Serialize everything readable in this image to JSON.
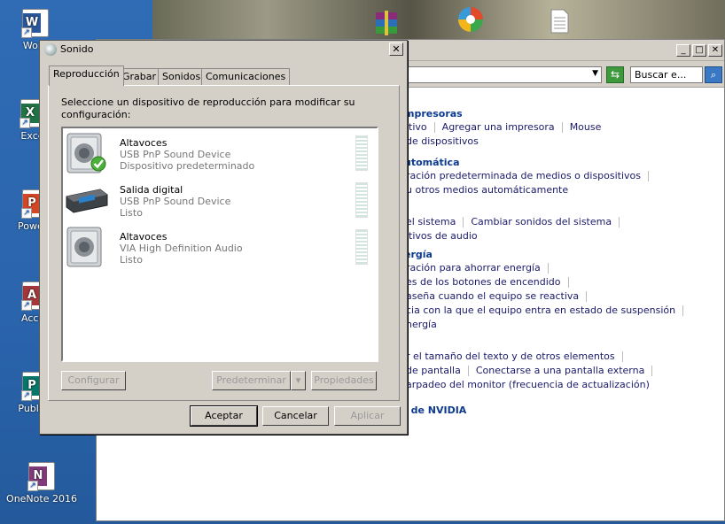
{
  "desktop": {
    "icons": [
      {
        "label": "Word",
        "color": "#2b579a",
        "glyph": "W"
      },
      {
        "label": "Excel",
        "color": "#217346",
        "glyph": "X"
      },
      {
        "label": "PowerP",
        "color": "#d24726",
        "glyph": "P"
      },
      {
        "label": "Acces",
        "color": "#a4373a",
        "glyph": "A"
      },
      {
        "label": "Publish",
        "color": "#077568",
        "glyph": "P"
      },
      {
        "label": "OneNote 2016",
        "color": "#80397b",
        "glyph": "N"
      }
    ]
  },
  "control_panel": {
    "search_placeholder": "Buscar e...",
    "lines": [
      {
        "type": "head",
        "text": "mpresoras"
      },
      {
        "type": "links",
        "items": [
          "itivo",
          "Agregar una impresora",
          "Mouse"
        ]
      },
      {
        "type": "links",
        "items": [
          "de dispositivos"
        ]
      },
      {
        "type": "head",
        "text": "utomática"
      },
      {
        "type": "links",
        "items": [
          "ración predeterminada de medios o dispositivos"
        ]
      },
      {
        "type": "links",
        "items": [
          "u otros medios automáticamente"
        ]
      },
      {
        "type": "links",
        "items": [
          "el sistema",
          "Cambiar sonidos del sistema"
        ]
      },
      {
        "type": "links",
        "items": [
          "itivos de audio"
        ]
      },
      {
        "type": "head",
        "text": "ergía"
      },
      {
        "type": "links",
        "items": [
          "ración para ahorrar energía"
        ]
      },
      {
        "type": "links",
        "items": [
          "es de los botones de encendido"
        ]
      },
      {
        "type": "links",
        "items": [
          "aseña cuando el equipo se reactiva"
        ]
      },
      {
        "type": "links",
        "items": [
          "cia con la que el equipo entra en estado de suspensión"
        ]
      },
      {
        "type": "links",
        "items": [
          "nergía"
        ]
      },
      {
        "type": "links",
        "items": [
          "r el tamaño del texto y de otros elementos"
        ]
      },
      {
        "type": "links",
        "items": [
          "de pantalla",
          "Conectarse a una pantalla externa"
        ]
      },
      {
        "type": "links",
        "items": [
          "arpadeo del monitor (frecuencia de actualización)"
        ]
      },
      {
        "type": "head",
        "text": "l de NVIDIA"
      }
    ]
  },
  "dialog": {
    "title": "Sonido",
    "tabs": [
      "Reproducción",
      "Grabar",
      "Sonidos",
      "Comunicaciones"
    ],
    "instructions": "Seleccione un dispositivo de reproducción para modificar su configuración:",
    "devices": [
      {
        "name": "Altavoces",
        "device": "USB PnP Sound Device",
        "status": "Dispositivo predeterminado",
        "is_default": true
      },
      {
        "name": "Salida digital",
        "device": "USB PnP Sound Device",
        "status": "Listo",
        "is_default": false
      },
      {
        "name": "Altavoces",
        "device": "VIA High Definition Audio",
        "status": "Listo",
        "is_default": false
      }
    ],
    "buttons": {
      "configure": "Configurar",
      "set_default": "Predeterminar",
      "properties": "Propiedades",
      "ok": "Aceptar",
      "cancel": "Cancelar",
      "apply": "Aplicar"
    }
  }
}
